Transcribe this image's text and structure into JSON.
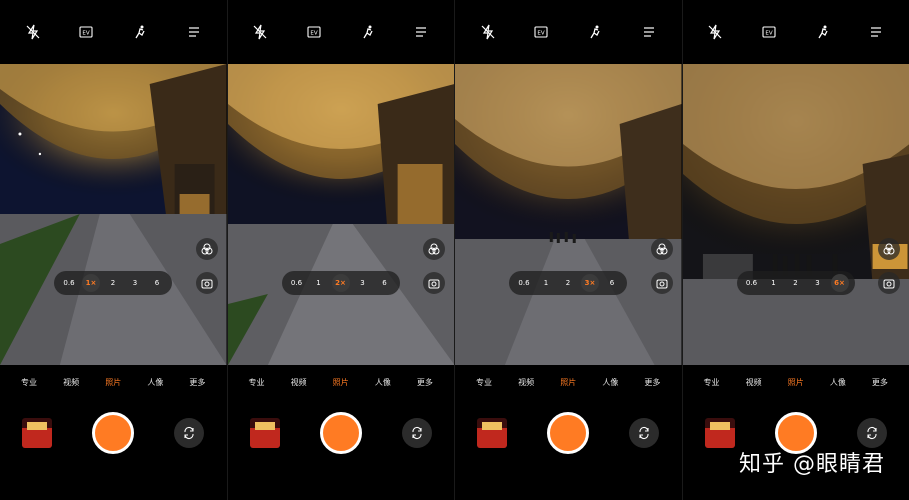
{
  "topbar": {
    "icons": [
      "flash-off-icon",
      "ev-icon",
      "ai-scene-icon",
      "menu-icon"
    ],
    "ev_label": "EV"
  },
  "panels": [
    {
      "zoom_levels": [
        "0.6",
        "1×",
        "2",
        "3",
        "6"
      ],
      "active_zoom_index": 1
    },
    {
      "zoom_levels": [
        "0.6",
        "1",
        "2×",
        "3",
        "6"
      ],
      "active_zoom_index": 2
    },
    {
      "zoom_levels": [
        "0.6",
        "1",
        "2",
        "3×",
        "6"
      ],
      "active_zoom_index": 3
    },
    {
      "zoom_levels": [
        "0.6",
        "1",
        "2",
        "3",
        "6×"
      ],
      "active_zoom_index": 4
    }
  ],
  "modes": [
    "专业",
    "视频",
    "照片",
    "人像",
    "更多"
  ],
  "active_mode": "照片",
  "watermark": "知乎 @眼睛君",
  "colors": {
    "accent": "#ff7b23",
    "lights": "#f6d27a",
    "background": "#000000"
  }
}
